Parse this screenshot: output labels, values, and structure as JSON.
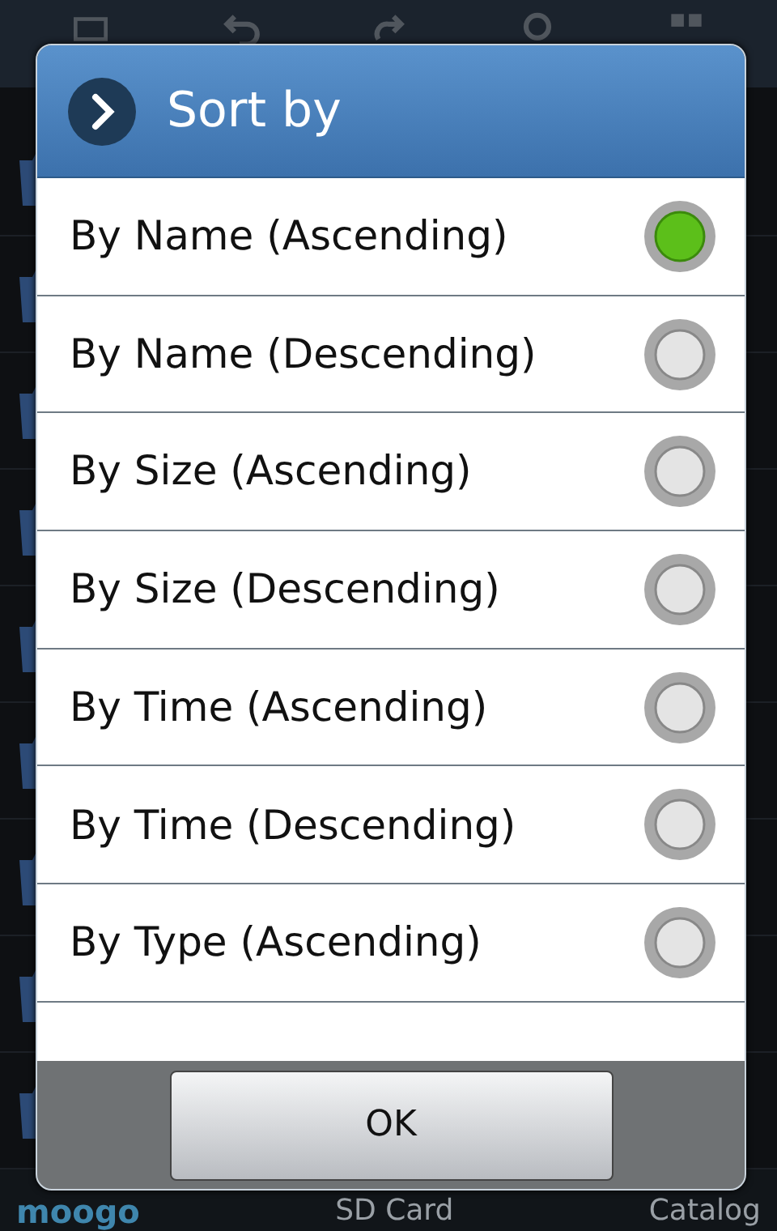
{
  "background": {
    "bottom_bar": [
      {
        "label": "moogo",
        "kind": "logo"
      },
      {
        "label": "SD Card",
        "kind": "tab"
      },
      {
        "label": "Catalog",
        "kind": "tab"
      }
    ]
  },
  "dialog": {
    "title": "Sort by",
    "options": [
      {
        "label": "By Name (Ascending)",
        "selected": true
      },
      {
        "label": "By Name (Descending)",
        "selected": false
      },
      {
        "label": "By Size (Ascending)",
        "selected": false
      },
      {
        "label": "By Size (Descending)",
        "selected": false
      },
      {
        "label": "By Time (Ascending)",
        "selected": false
      },
      {
        "label": "By Time (Descending)",
        "selected": false
      },
      {
        "label": "By Type (Ascending)",
        "selected": false
      }
    ],
    "buttons": [
      "OK"
    ]
  }
}
